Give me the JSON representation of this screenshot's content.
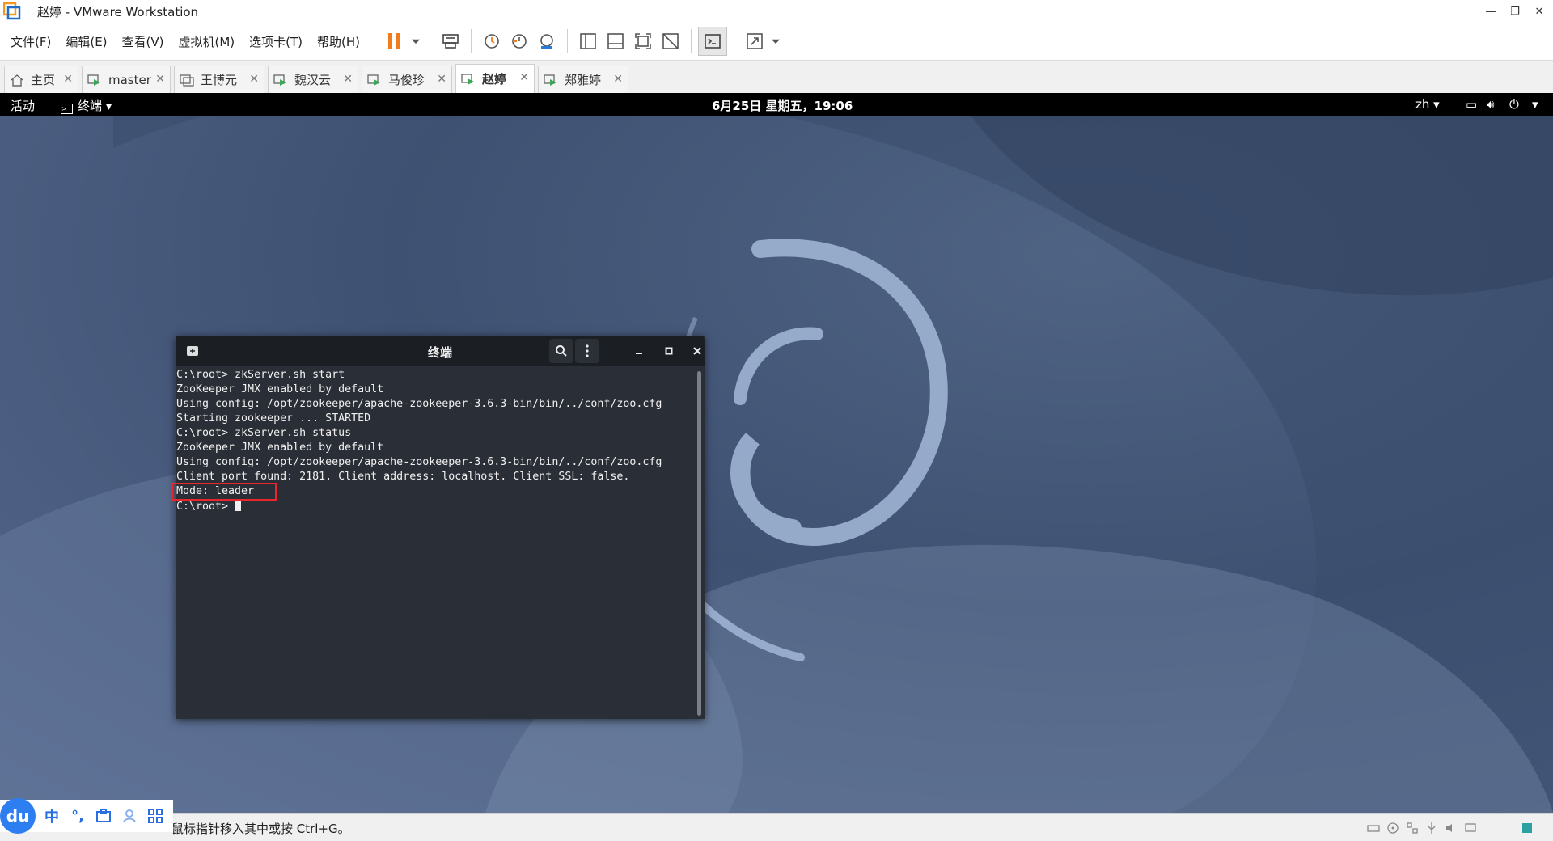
{
  "window": {
    "title": "赵婷 - VMware Workstation"
  },
  "menu": [
    "文件(F)",
    "编辑(E)",
    "查看(V)",
    "虚拟机(M)",
    "选项卡(T)",
    "帮助(H)"
  ],
  "tabs": [
    {
      "label": "主页",
      "icon": "home-icon",
      "active": false
    },
    {
      "label": "master",
      "icon": "vm-icon",
      "active": false
    },
    {
      "label": "王博元",
      "icon": "vm-icon",
      "active": false
    },
    {
      "label": "魏汉云",
      "icon": "vm-icon",
      "active": false
    },
    {
      "label": "马俊珍",
      "icon": "vm-icon",
      "active": false
    },
    {
      "label": "赵婷",
      "icon": "vm-icon",
      "active": true
    },
    {
      "label": "郑雅婷",
      "icon": "vm-icon",
      "active": false
    }
  ],
  "guest_panel": {
    "activities": "活动",
    "app_menu": "终端",
    "datetime": "6月25日 星期五，19:06",
    "lang": "zh"
  },
  "terminal": {
    "title": "终端",
    "lines": [
      "C:\\root> zkServer.sh start",
      "ZooKeeper JMX enabled by default",
      "Using config: /opt/zookeeper/apache-zookeeper-3.6.3-bin/bin/../conf/zoo.cfg",
      "Starting zookeeper ... STARTED",
      "C:\\root> zkServer.sh status",
      "ZooKeeper JMX enabled by default",
      "Using config: /opt/zookeeper/apache-zookeeper-3.6.3-bin/bin/../conf/zoo.cfg",
      "Client port found: 2181. Client address: localhost. Client SSL: false.",
      "Mode: leader"
    ],
    "prompt": "C:\\root> "
  },
  "statusbar": {
    "text": "鼠标指针移入其中或按 Ctrl+G。"
  },
  "ime": {
    "logo": "du",
    "mode": "中",
    "punct": "°,"
  },
  "colors": {
    "accent_orange": "#f07c1e",
    "highlight_red": "#e8262c",
    "ime_blue": "#2d7ef1"
  }
}
